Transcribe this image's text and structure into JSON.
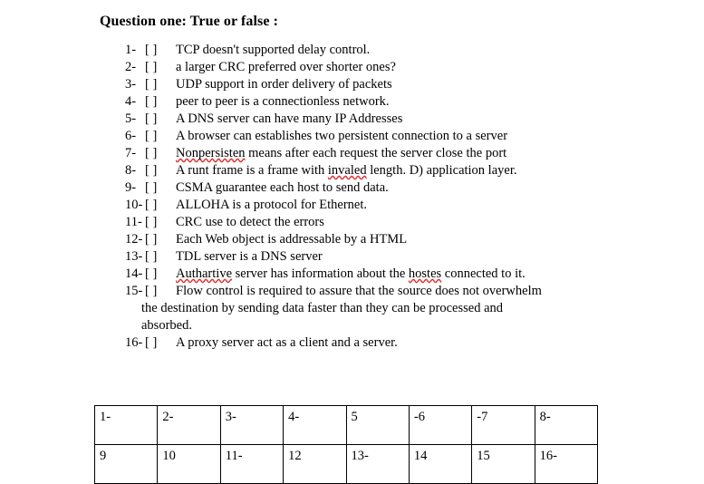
{
  "document": {
    "title": "Question one: True or false :",
    "questions": [
      {
        "num": "1-",
        "box": "[      ]",
        "parts": [
          {
            "t": "TCP doesn't  supported   delay control."
          }
        ]
      },
      {
        "num": "2-",
        "box": "[      ]",
        "parts": [
          {
            "t": "a larger CRC  preferred over shorter ones?"
          }
        ]
      },
      {
        "num": "3-",
        "box": "[      ]",
        "parts": [
          {
            "t": "UDP support in order delivery of packets"
          }
        ]
      },
      {
        "num": "4-",
        "box": "[      ]",
        "parts": [
          {
            "t": " peer to peer is a connectionless network."
          }
        ]
      },
      {
        "num": "5-",
        "box": "[      ]",
        "parts": [
          {
            "t": "A DNS server can have many IP Addresses"
          }
        ]
      },
      {
        "num": "6-",
        "box": "[      ]",
        "parts": [
          {
            "t": "A browser can establishes two persistent connection to a server"
          }
        ]
      },
      {
        "num": "7-",
        "box": "[      ]",
        "parts": [
          {
            "t": " "
          },
          {
            "t": "Nonpersisten",
            "spell": true
          },
          {
            "t": " means after each request the server close the port"
          }
        ]
      },
      {
        "num": "8-",
        "box": "[      ]",
        "parts": [
          {
            "t": "A runt frame is a frame with "
          },
          {
            "t": "invaled",
            "spell": true
          },
          {
            "t": " length. D) application layer."
          }
        ]
      },
      {
        "num": "9-",
        "box": "[      ]",
        "parts": [
          {
            "t": " CSMA guarantee each host to send data."
          }
        ]
      },
      {
        "num": "10-",
        "box": "[     ]",
        "parts": [
          {
            "t": "ALLOHA is a protocol for Ethernet."
          }
        ]
      },
      {
        "num": "11-",
        "box": "[     ]",
        "parts": [
          {
            "t": "CRC use to detect the errors"
          }
        ]
      },
      {
        "num": "12-",
        "box": "[     ]",
        "parts": [
          {
            "t": "Each Web object is addressable by a  HTML"
          }
        ]
      },
      {
        "num": "13-",
        "box": "[     ]",
        "parts": [
          {
            "t": "TDL server is a DNS server"
          }
        ]
      },
      {
        "num": "14-",
        "box": "[     ]",
        "parts": [
          {
            "t": ""
          },
          {
            "t": "Authartive",
            "spell": true
          },
          {
            "t": " server has information about the "
          },
          {
            "t": "hostes",
            "spell": true
          },
          {
            "t": " connected to it."
          }
        ]
      },
      {
        "num": "15-",
        "box": "[     ]",
        "parts": [
          {
            "t": "Flow control is required to assure that the source does not overwhelm"
          }
        ],
        "continuations": [
          "the destination by sending data faster than they can be processed and",
          "absorbed."
        ]
      },
      {
        "num": "16-",
        "box": "[     ]",
        "parts": [
          {
            "t": "A proxy server act as a client and a server."
          }
        ]
      }
    ],
    "answer_table": {
      "rows": [
        [
          "1-",
          "2-",
          "3-",
          "4-",
          "5",
          "-6",
          "-7",
          "8-"
        ],
        [
          "9",
          "10",
          "11-",
          "12",
          "13-",
          "14",
          "15",
          "16-"
        ]
      ]
    }
  },
  "colors": {
    "text": "#000000",
    "background": "#ffffff",
    "spellcheck_underline": "#e03030",
    "table_border": "#000000"
  }
}
